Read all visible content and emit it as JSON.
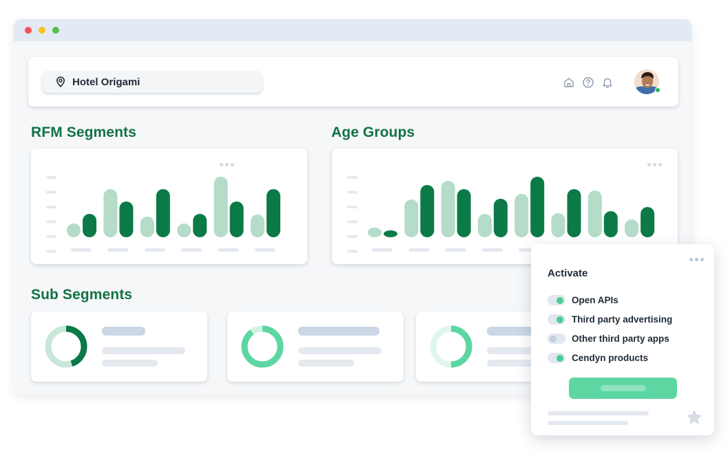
{
  "header": {
    "location_name": "Hotel Origami",
    "icons": [
      "map-pin-icon",
      "home-icon",
      "help-icon",
      "bell-icon"
    ]
  },
  "sections": {
    "rfm_title": "RFM Segments",
    "age_title": "Age Groups",
    "sub_title": "Sub Segments"
  },
  "chart_data": [
    {
      "type": "bar",
      "title": "RFM Segments",
      "categories": [
        "",
        "",
        "",
        "",
        "",
        ""
      ],
      "series": [
        {
          "values": [
            20,
            70,
            30,
            20,
            88,
            33
          ]
        },
        {
          "values": [
            34,
            52,
            70,
            34,
            52,
            70
          ]
        }
      ],
      "ylim": [
        0,
        100
      ],
      "axis_labels_visible": false
    },
    {
      "type": "bar",
      "title": "Age Groups",
      "categories": [
        "",
        "",
        "",
        "",
        "",
        "",
        "",
        ""
      ],
      "series": [
        {
          "values": [
            14,
            55,
            82,
            34,
            63,
            35,
            68,
            26
          ]
        },
        {
          "values": [
            10,
            76,
            70,
            56,
            88,
            70,
            38,
            44
          ]
        }
      ],
      "ylim": [
        0,
        100
      ],
      "axis_labels_visible": false
    }
  ],
  "sub_segments": [
    {
      "donut_fraction": 0.45,
      "fg": "#0b7a47",
      "bg": "#c8e7d8"
    },
    {
      "donut_fraction": 0.9,
      "fg": "#5dd6a2",
      "bg": "#d2f3e4"
    },
    {
      "donut_fraction": 0.5,
      "fg": "#5dd6a2",
      "bg": "#e0f7ec"
    }
  ],
  "activate_popup": {
    "title": "Activate",
    "options": [
      {
        "label": "Open APIs",
        "enabled": true
      },
      {
        "label": "Third party advertising",
        "enabled": true
      },
      {
        "label": "Other third party apps",
        "enabled": false
      },
      {
        "label": "Cendyn products",
        "enabled": true
      }
    ]
  },
  "colors": {
    "dark_green": "#0b7a47",
    "light_green": "#b5dbc9",
    "accent_mint": "#5dd6a2",
    "title_green": "#127244"
  }
}
